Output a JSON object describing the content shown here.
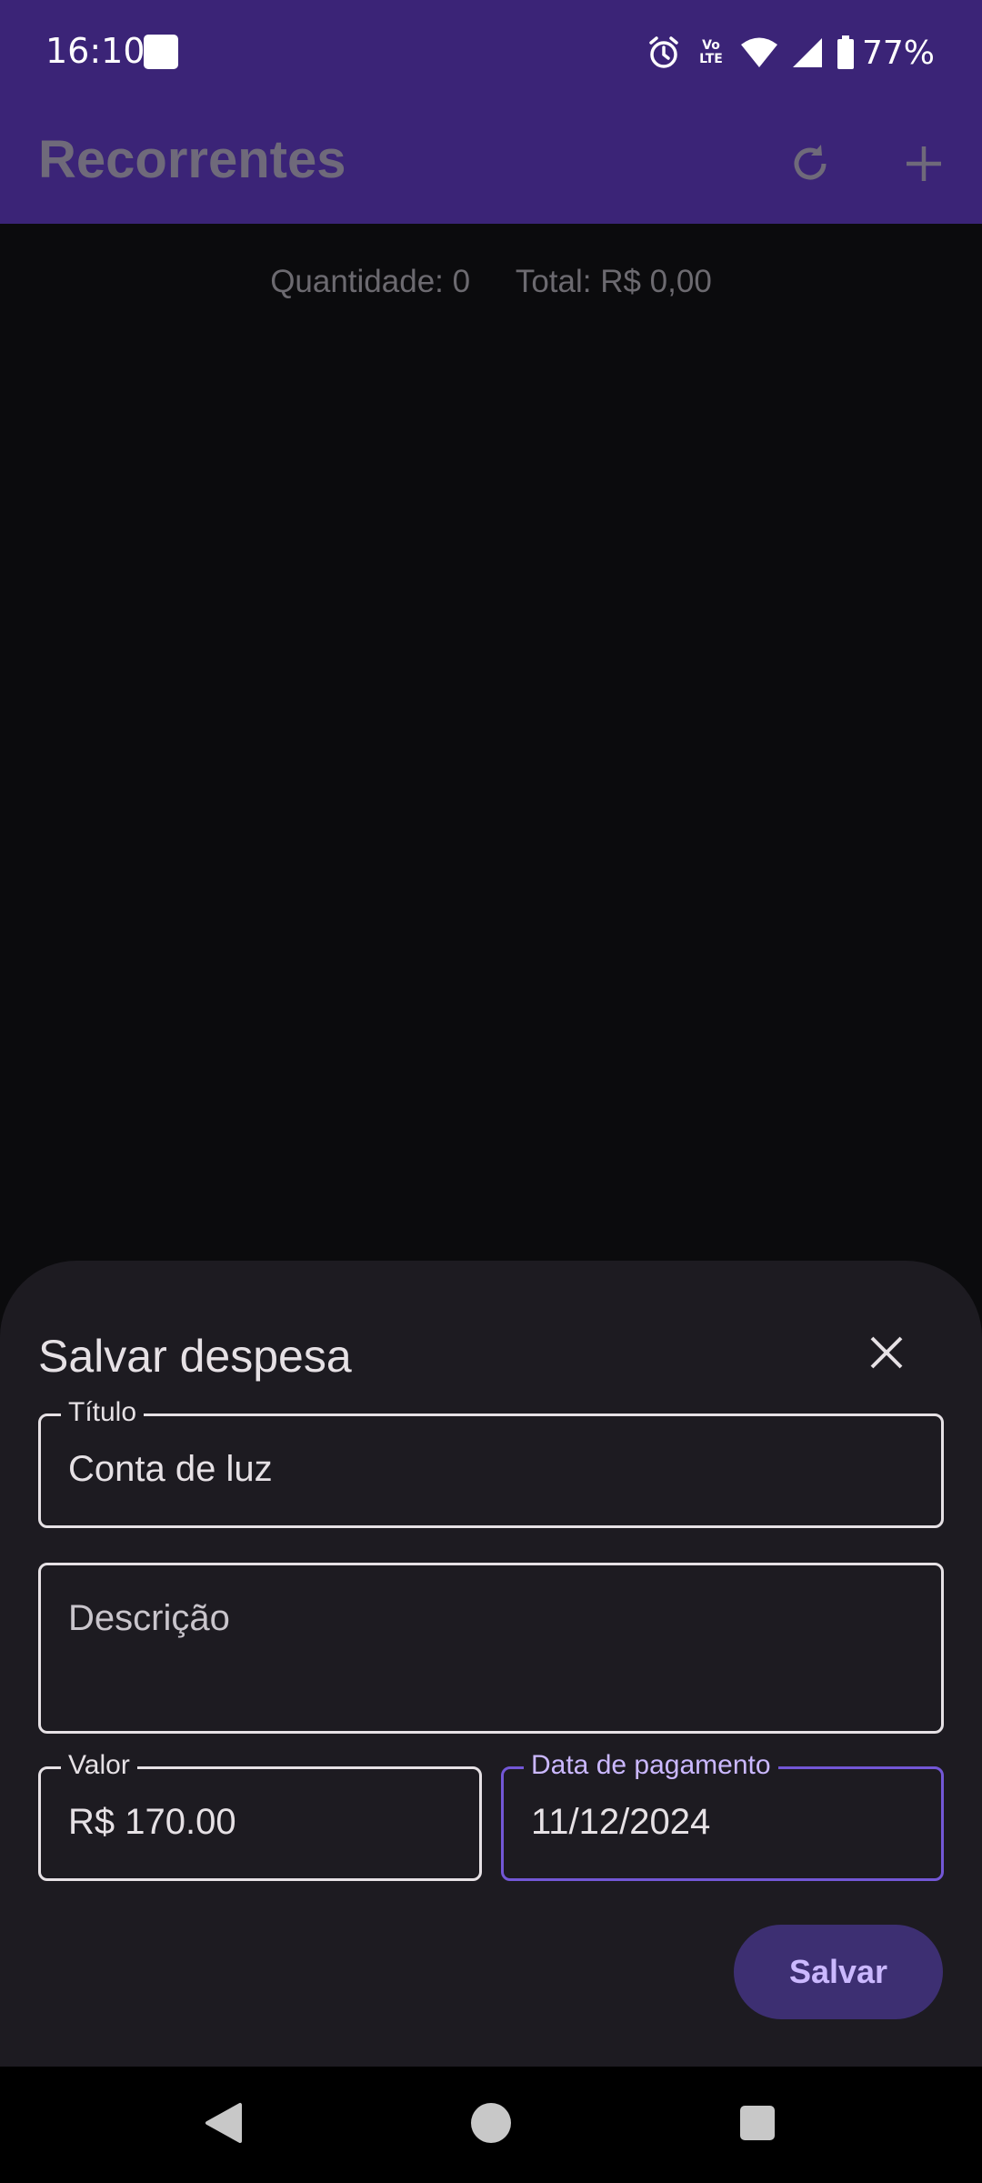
{
  "status_bar": {
    "time": "16:10",
    "network_label": "Vo\nLTE",
    "battery": "77%",
    "icons": [
      "notification-square-icon",
      "alarm-icon",
      "volte-icon",
      "wifi-icon",
      "signal-icon",
      "battery-icon"
    ]
  },
  "app_bar": {
    "title": "Recorrentes",
    "actions": [
      "refresh-icon",
      "add-icon"
    ]
  },
  "summary": {
    "quantity": "Quantidade: 0",
    "total": "Total: R$ 0,00"
  },
  "sheet": {
    "title": "Salvar despesa",
    "fields": {
      "titulo": {
        "label": "Título",
        "value": "Conta de luz"
      },
      "descricao": {
        "placeholder": "Descrição",
        "value": ""
      },
      "valor": {
        "label": "Valor",
        "value": "R$ 170.00"
      },
      "data": {
        "label": "Data de pagamento",
        "value": "11/12/2024"
      }
    },
    "save_label": "Salvar"
  },
  "colors": {
    "app_bar": "#3b2477",
    "background": "#0b0b0d",
    "sheet": "#1d1b21",
    "focus_border": "#7357d6",
    "button": "#3d2f72",
    "button_text": "#cbb8ff"
  }
}
